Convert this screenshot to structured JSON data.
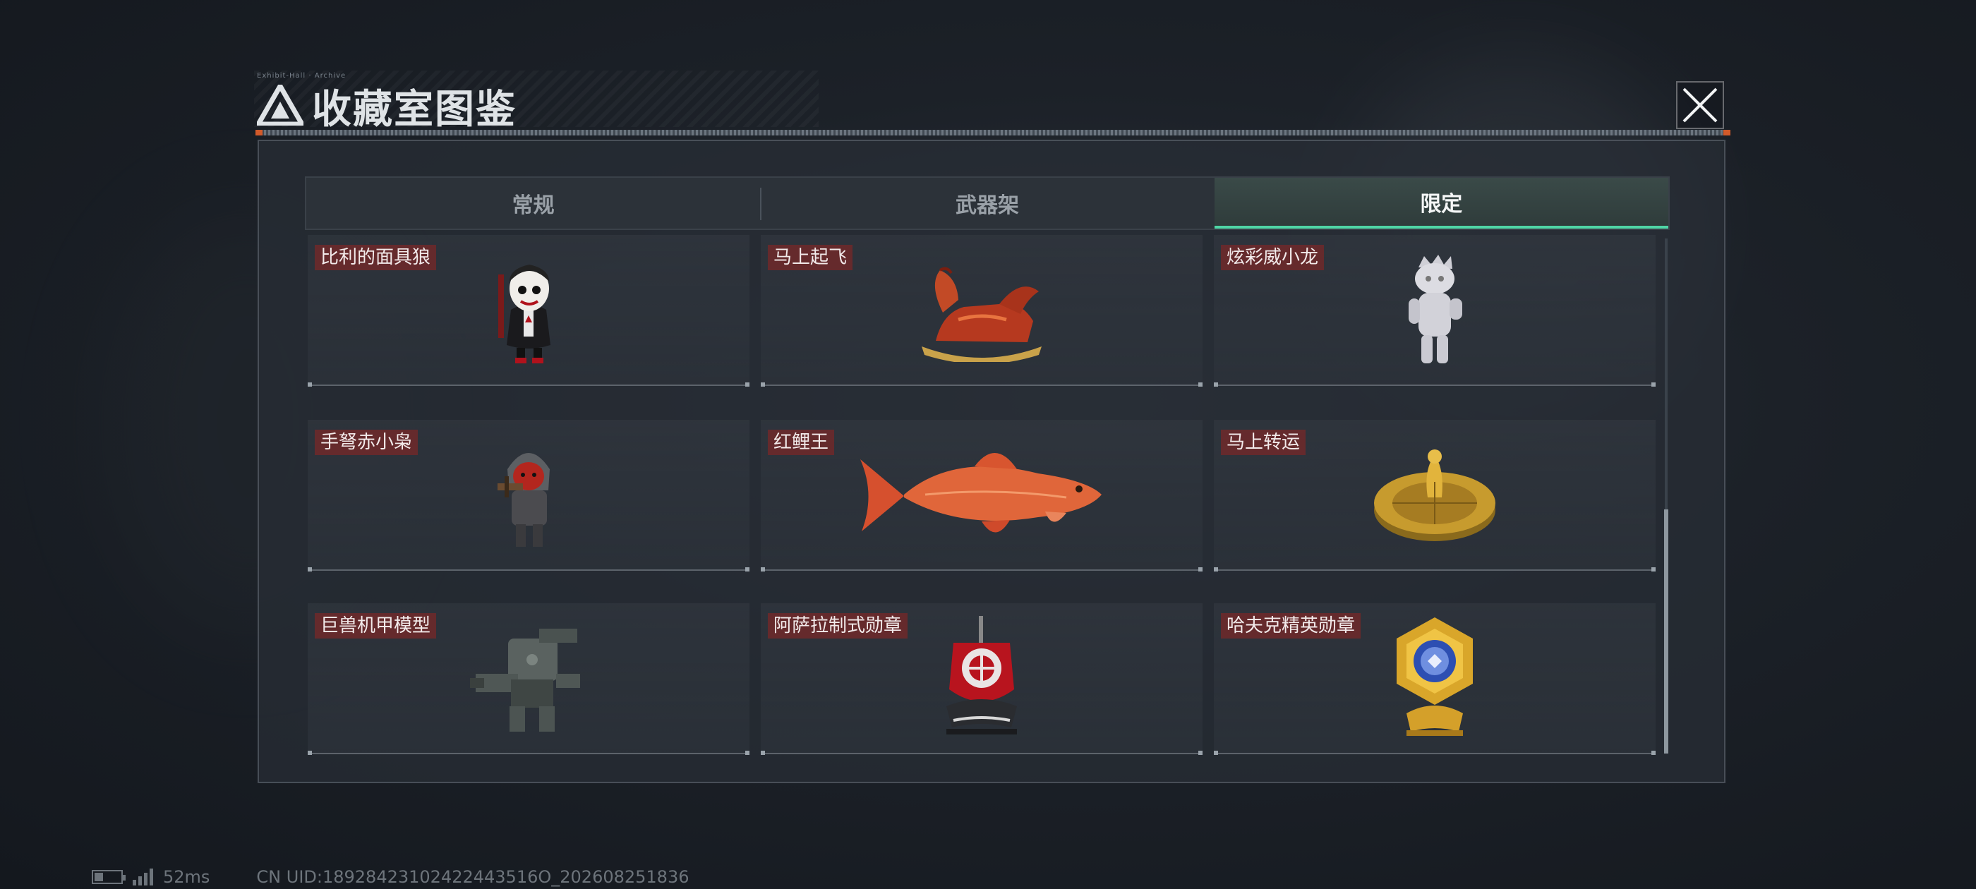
{
  "window": {
    "small_caption": "Exhibit-Hall · Archive",
    "title": "收藏室图鉴",
    "close_label": "关闭"
  },
  "tabs": [
    {
      "label": "常规",
      "active": false
    },
    {
      "label": "武器架",
      "active": false
    },
    {
      "label": "限定",
      "active": true
    }
  ],
  "items": [
    {
      "name": "比利的面具狼",
      "icon": "masked-doll-figure"
    },
    {
      "name": "马上起飞",
      "icon": "red-rocking-horse"
    },
    {
      "name": "炫彩威小龙",
      "icon": "white-dragon-figure"
    },
    {
      "name": "手弩赤小枭",
      "icon": "hooded-crossbow-figure"
    },
    {
      "name": "红鲤王",
      "icon": "red-carp-fish"
    },
    {
      "name": "马上转运",
      "icon": "golden-horse-wheel"
    },
    {
      "name": "巨兽机甲模型",
      "icon": "mech-model"
    },
    {
      "name": "阿萨拉制式勋章",
      "icon": "red-emblem-medal"
    },
    {
      "name": "哈夫克精英勋章",
      "icon": "gold-hex-medal"
    }
  ],
  "scroll": {
    "position_fraction": 0.52
  },
  "footer": {
    "ping": "52ms",
    "uid": "CN UID:18928423102422443516O_202608251836"
  },
  "colors": {
    "accent": "#4fd6a6",
    "label_bg": "#782828"
  }
}
